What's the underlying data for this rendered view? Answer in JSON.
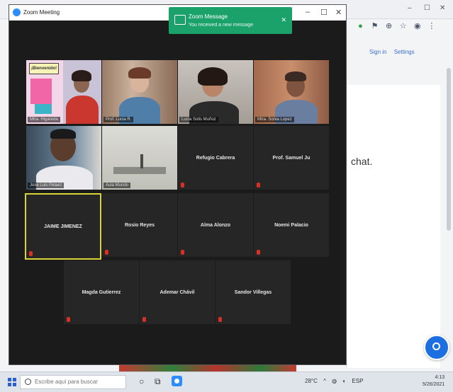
{
  "zoom": {
    "title": "Zoom Meeting",
    "window_controls": [
      "–",
      "☐",
      "✕"
    ],
    "notification": {
      "title": "Zoom Message",
      "subtitle": "You received a new message",
      "close": "✕"
    },
    "participants": [
      {
        "name": "Mtra. Higareda",
        "video": true
      },
      {
        "name": "Prof. Lucia R.",
        "video": true
      },
      {
        "name": "Lucia Solis Muñoz",
        "video": true
      },
      {
        "name": "Mtra. Sonia Lopez",
        "video": true
      },
      {
        "name": "Jose Luis Pelaez",
        "video": true
      },
      {
        "name": "Aula Mundo",
        "video": true
      },
      {
        "name": "Refugio Cabrera",
        "video": false
      },
      {
        "name": "Prof. Samuel Ju",
        "video": false
      },
      {
        "name": "JAIME JIMENEZ",
        "video": false,
        "active": true
      },
      {
        "name": "Rosio Reyes",
        "video": false
      },
      {
        "name": "Alma Alonzo",
        "video": false
      },
      {
        "name": "Noemi Palacio",
        "video": false
      },
      {
        "name": "Magda Gutierrez",
        "video": false
      },
      {
        "name": "Ademar Chávil",
        "video": false
      },
      {
        "name": "Sandor Villegas",
        "video": false
      }
    ],
    "first_tile_sign": "¡Bienvenido!"
  },
  "browser": {
    "toolbar_icons": [
      "puzzle-icon",
      "bookmark-icon",
      "lock-icon",
      "star-icon",
      "profile-icon",
      "menu-icon"
    ],
    "doc_links": [
      "Sign in",
      "Settings"
    ],
    "doc_text": "chat."
  },
  "taskbar": {
    "search_placeholder": "Escribe aquí para buscar",
    "tray": [
      "28°C",
      "ESP"
    ],
    "time": "4:13",
    "date": "5/26/2021"
  },
  "colors": {
    "zoom_blue": "#2d8cff",
    "notification_green": "#1ba26b",
    "active_speaker": "#d9d433",
    "muted_red": "#d93025"
  }
}
